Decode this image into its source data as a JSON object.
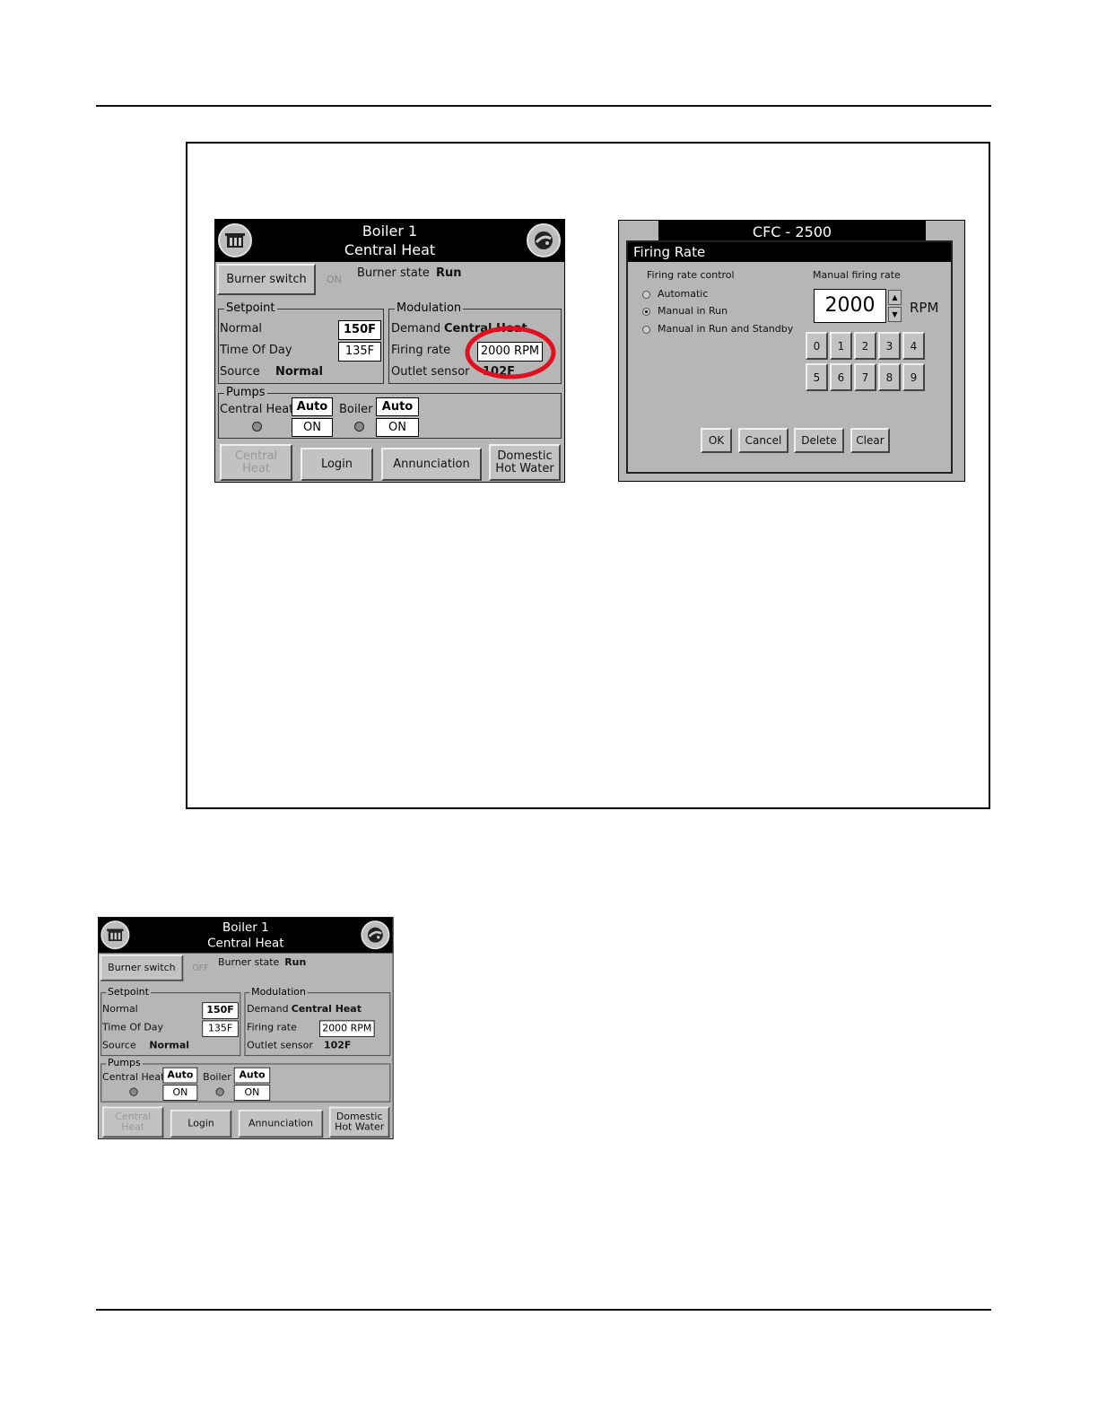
{
  "boiler_screen": {
    "title_line1": "Boiler 1",
    "title_line2": "Central Heat",
    "burner_switch_label": "Burner switch",
    "burner_switch_state": "ON",
    "burner_state_label": "Burner state",
    "burner_state_value": "Run",
    "setpoint": {
      "group_label": "Setpoint",
      "normal_label": "Normal",
      "normal_value": "150F",
      "tod_label": "Time Of Day",
      "tod_value": "135F",
      "source_label": "Source",
      "source_value": "Normal"
    },
    "modulation": {
      "group_label": "Modulation",
      "demand_label": "Demand",
      "demand_value": "Central Heat",
      "firing_label": "Firing rate",
      "firing_value": "2000 RPM",
      "outlet_label": "Outlet sensor",
      "outlet_value": "102F"
    },
    "pumps": {
      "group_label": "Pumps",
      "central_label": "Central Heat",
      "central_mode": "Auto",
      "central_state": "ON",
      "boiler_label": "Boiler",
      "boiler_mode": "Auto",
      "boiler_state": "ON"
    },
    "nav": {
      "central_line1": "Central",
      "central_line2": "Heat",
      "login": "Login",
      "annunciation": "Annunciation",
      "domestic_line1": "Domestic",
      "domestic_line2": "Hot Water"
    }
  },
  "boiler_screen_lower": {
    "burner_switch_state": "OFF"
  },
  "dialog": {
    "background_title": "CFC - 2500",
    "title": "Firing Rate",
    "control_label": "Firing rate control",
    "options": [
      "Automatic",
      "Manual in Run",
      "Manual in Run and Standby"
    ],
    "manual_label": "Manual firing rate",
    "manual_value": "2000",
    "unit": "RPM",
    "keys": [
      "0",
      "1",
      "2",
      "3",
      "4",
      "5",
      "6",
      "7",
      "8",
      "9"
    ],
    "ok": "OK",
    "cancel": "Cancel",
    "delete": "Delete",
    "clear": "Clear"
  },
  "colors": {
    "highlight": "#e01020",
    "panel_bg": "#b6b6b6"
  }
}
